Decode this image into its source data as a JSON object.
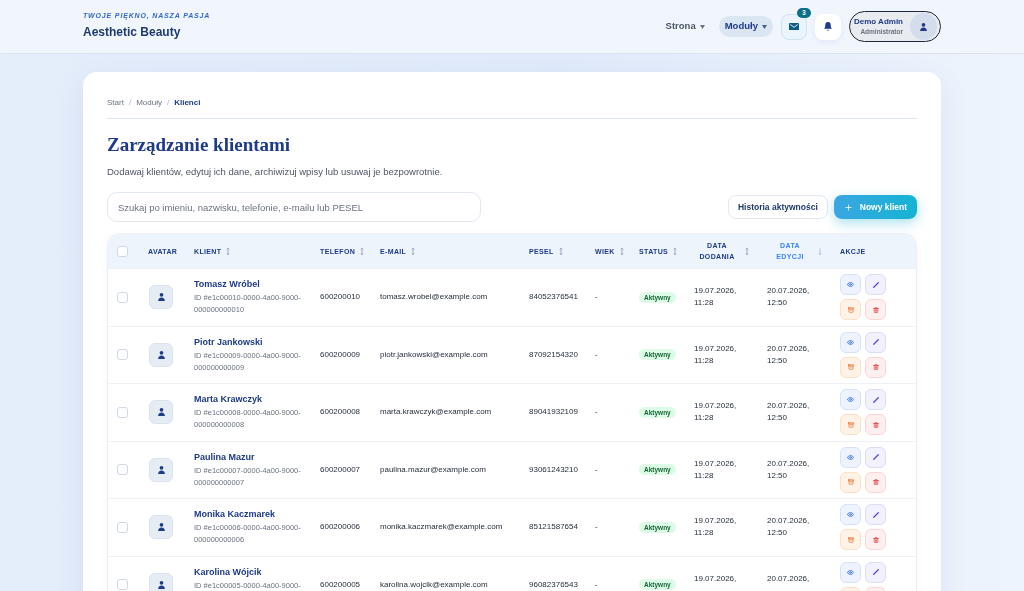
{
  "header": {
    "tagline": "TWOJE PIĘKNO, NASZA PASJA",
    "brand": "Aesthetic Beauty",
    "nav": [
      {
        "label": "Strona",
        "selected": false
      },
      {
        "label": "Moduły",
        "selected": true
      }
    ],
    "messages_badge": "3",
    "user": {
      "name": "Demo Admin",
      "role": "Administrator"
    }
  },
  "breadcrumb": {
    "separator": "/",
    "items": [
      {
        "label": "Start",
        "selected": false
      },
      {
        "label": "Moduły",
        "selected": false
      },
      {
        "label": "Klienci",
        "selected": true
      }
    ]
  },
  "page": {
    "title": "Zarządzanie klientami",
    "description": "Dodawaj klientów, edytuj ich dane, archiwizuj wpisy lub usuwaj je bezpowrotnie."
  },
  "search": {
    "placeholder": "Szukaj po imieniu, nazwisku, telefonie, e-mailu lub PESEL"
  },
  "buttons": [
    {
      "label": "Historia aktywności",
      "kind": "secondary"
    },
    {
      "label": "Nowy klient",
      "kind": "primary"
    }
  ],
  "table": {
    "select_all": {
      "checked": false
    },
    "columns": [
      {
        "label": "AVATAR",
        "sortable": false,
        "sorted": false
      },
      {
        "label": "KLIENT",
        "sortable": true,
        "sorted": false
      },
      {
        "label": "TELEFON",
        "sortable": true,
        "sorted": false
      },
      {
        "label": "E-MAIL",
        "sortable": true,
        "sorted": false
      },
      {
        "label": "PESEL",
        "sortable": true,
        "sorted": false
      },
      {
        "label": "WIEK",
        "sortable": true,
        "sorted": false
      },
      {
        "label": "STATUS",
        "sortable": true,
        "sorted": false
      },
      {
        "label": "DATA DODANIA",
        "sortable": true,
        "sorted": false
      },
      {
        "label": "DATA EDYCJI",
        "sortable": true,
        "sorted": true
      },
      {
        "label": "AKCJE",
        "sortable": false,
        "sorted": false
      }
    ],
    "rows": [
      {
        "checked": false,
        "name": "Tomasz Wróbel",
        "id": "ID #e1c00010-0000-4a00-9000-000000000010",
        "phone": "600200010",
        "email": "tomasz.wrobel@example.com",
        "pesel": "84052376541",
        "age": "-",
        "status": "Aktywny",
        "date_added": "19.07.2026, 11:28",
        "date_edited": "20.07.2026, 12:50"
      },
      {
        "checked": false,
        "name": "Piotr Jankowski",
        "id": "ID #e1c00009-0000-4a00-9000-000000000009",
        "phone": "600200009",
        "email": "piotr.jankowski@example.com",
        "pesel": "87092154320",
        "age": "-",
        "status": "Aktywny",
        "date_added": "19.07.2026, 11:28",
        "date_edited": "20.07.2026, 12:50"
      },
      {
        "checked": false,
        "name": "Marta Krawczyk",
        "id": "ID #e1c00008-0000-4a00-9000-000000000008",
        "phone": "600200008",
        "email": "marta.krawczyk@example.com",
        "pesel": "89041932109",
        "age": "-",
        "status": "Aktywny",
        "date_added": "19.07.2026, 11:28",
        "date_edited": "20.07.2026, 12:50"
      },
      {
        "checked": false,
        "name": "Paulina Mazur",
        "id": "ID #e1c00007-0000-4a00-9000-000000000007",
        "phone": "600200007",
        "email": "paulina.mazur@example.com",
        "pesel": "93061243210",
        "age": "-",
        "status": "Aktywny",
        "date_added": "19.07.2026, 11:28",
        "date_edited": "20.07.2026, 12:50"
      },
      {
        "checked": false,
        "name": "Monika Kaczmarek",
        "id": "ID #e1c00006-0000-4a00-9000-000000000006",
        "phone": "600200006",
        "email": "monika.kaczmarek@example.com",
        "pesel": "85121587654",
        "age": "-",
        "status": "Aktywny",
        "date_added": "19.07.2026, 11:28",
        "date_edited": "20.07.2026, 12:50"
      },
      {
        "checked": false,
        "name": "Karolina Wójcik",
        "id": "ID #e1c00005-0000-4a00-9000-",
        "phone": "600200005",
        "email": "karolina.wojcik@example.com",
        "pesel": "96082376543",
        "age": "-",
        "status": "Aktywny",
        "date_added": "19.07.2026,",
        "date_edited": "20.07.2026,"
      }
    ]
  }
}
